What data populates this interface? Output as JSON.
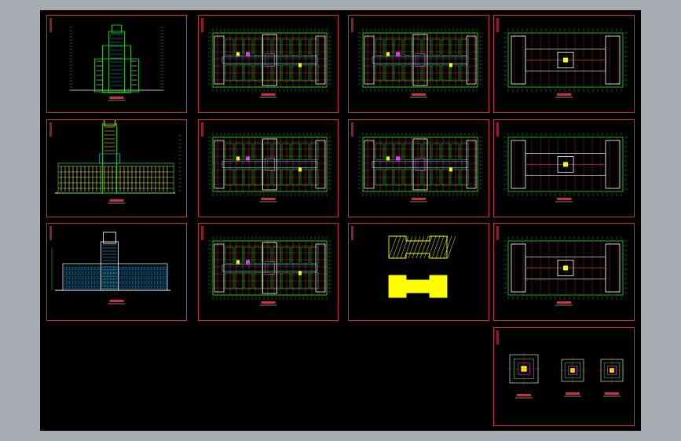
{
  "viewport": {
    "background": "#000000",
    "frame": "#a7abb2"
  },
  "colors": {
    "border": "#c8304a",
    "grid": "#d0303a",
    "wall": "#20e020",
    "dim": "#30c8ff",
    "fill": "#ffff00",
    "white": "#ffffff",
    "magenta": "#ff30ff"
  },
  "sheets": [
    {
      "id": "side-elevation",
      "kind": "tower-elevation"
    },
    {
      "id": "floor-plan-1",
      "kind": "floor-plan"
    },
    {
      "id": "floor-plan-2",
      "kind": "floor-plan"
    },
    {
      "id": "roof-plan-1",
      "kind": "roof-plan"
    },
    {
      "id": "rear-elevation",
      "kind": "long-elevation"
    },
    {
      "id": "floor-plan-3",
      "kind": "floor-plan"
    },
    {
      "id": "floor-plan-4",
      "kind": "floor-plan"
    },
    {
      "id": "roof-plan-2",
      "kind": "roof-plan"
    },
    {
      "id": "front-elevation",
      "kind": "front-elevation"
    },
    {
      "id": "floor-plan-5",
      "kind": "floor-plan"
    },
    {
      "id": "section-details",
      "kind": "sections"
    },
    {
      "id": "roof-plan-3",
      "kind": "roof-plan"
    },
    {
      "id": "node-details",
      "kind": "details"
    }
  ]
}
